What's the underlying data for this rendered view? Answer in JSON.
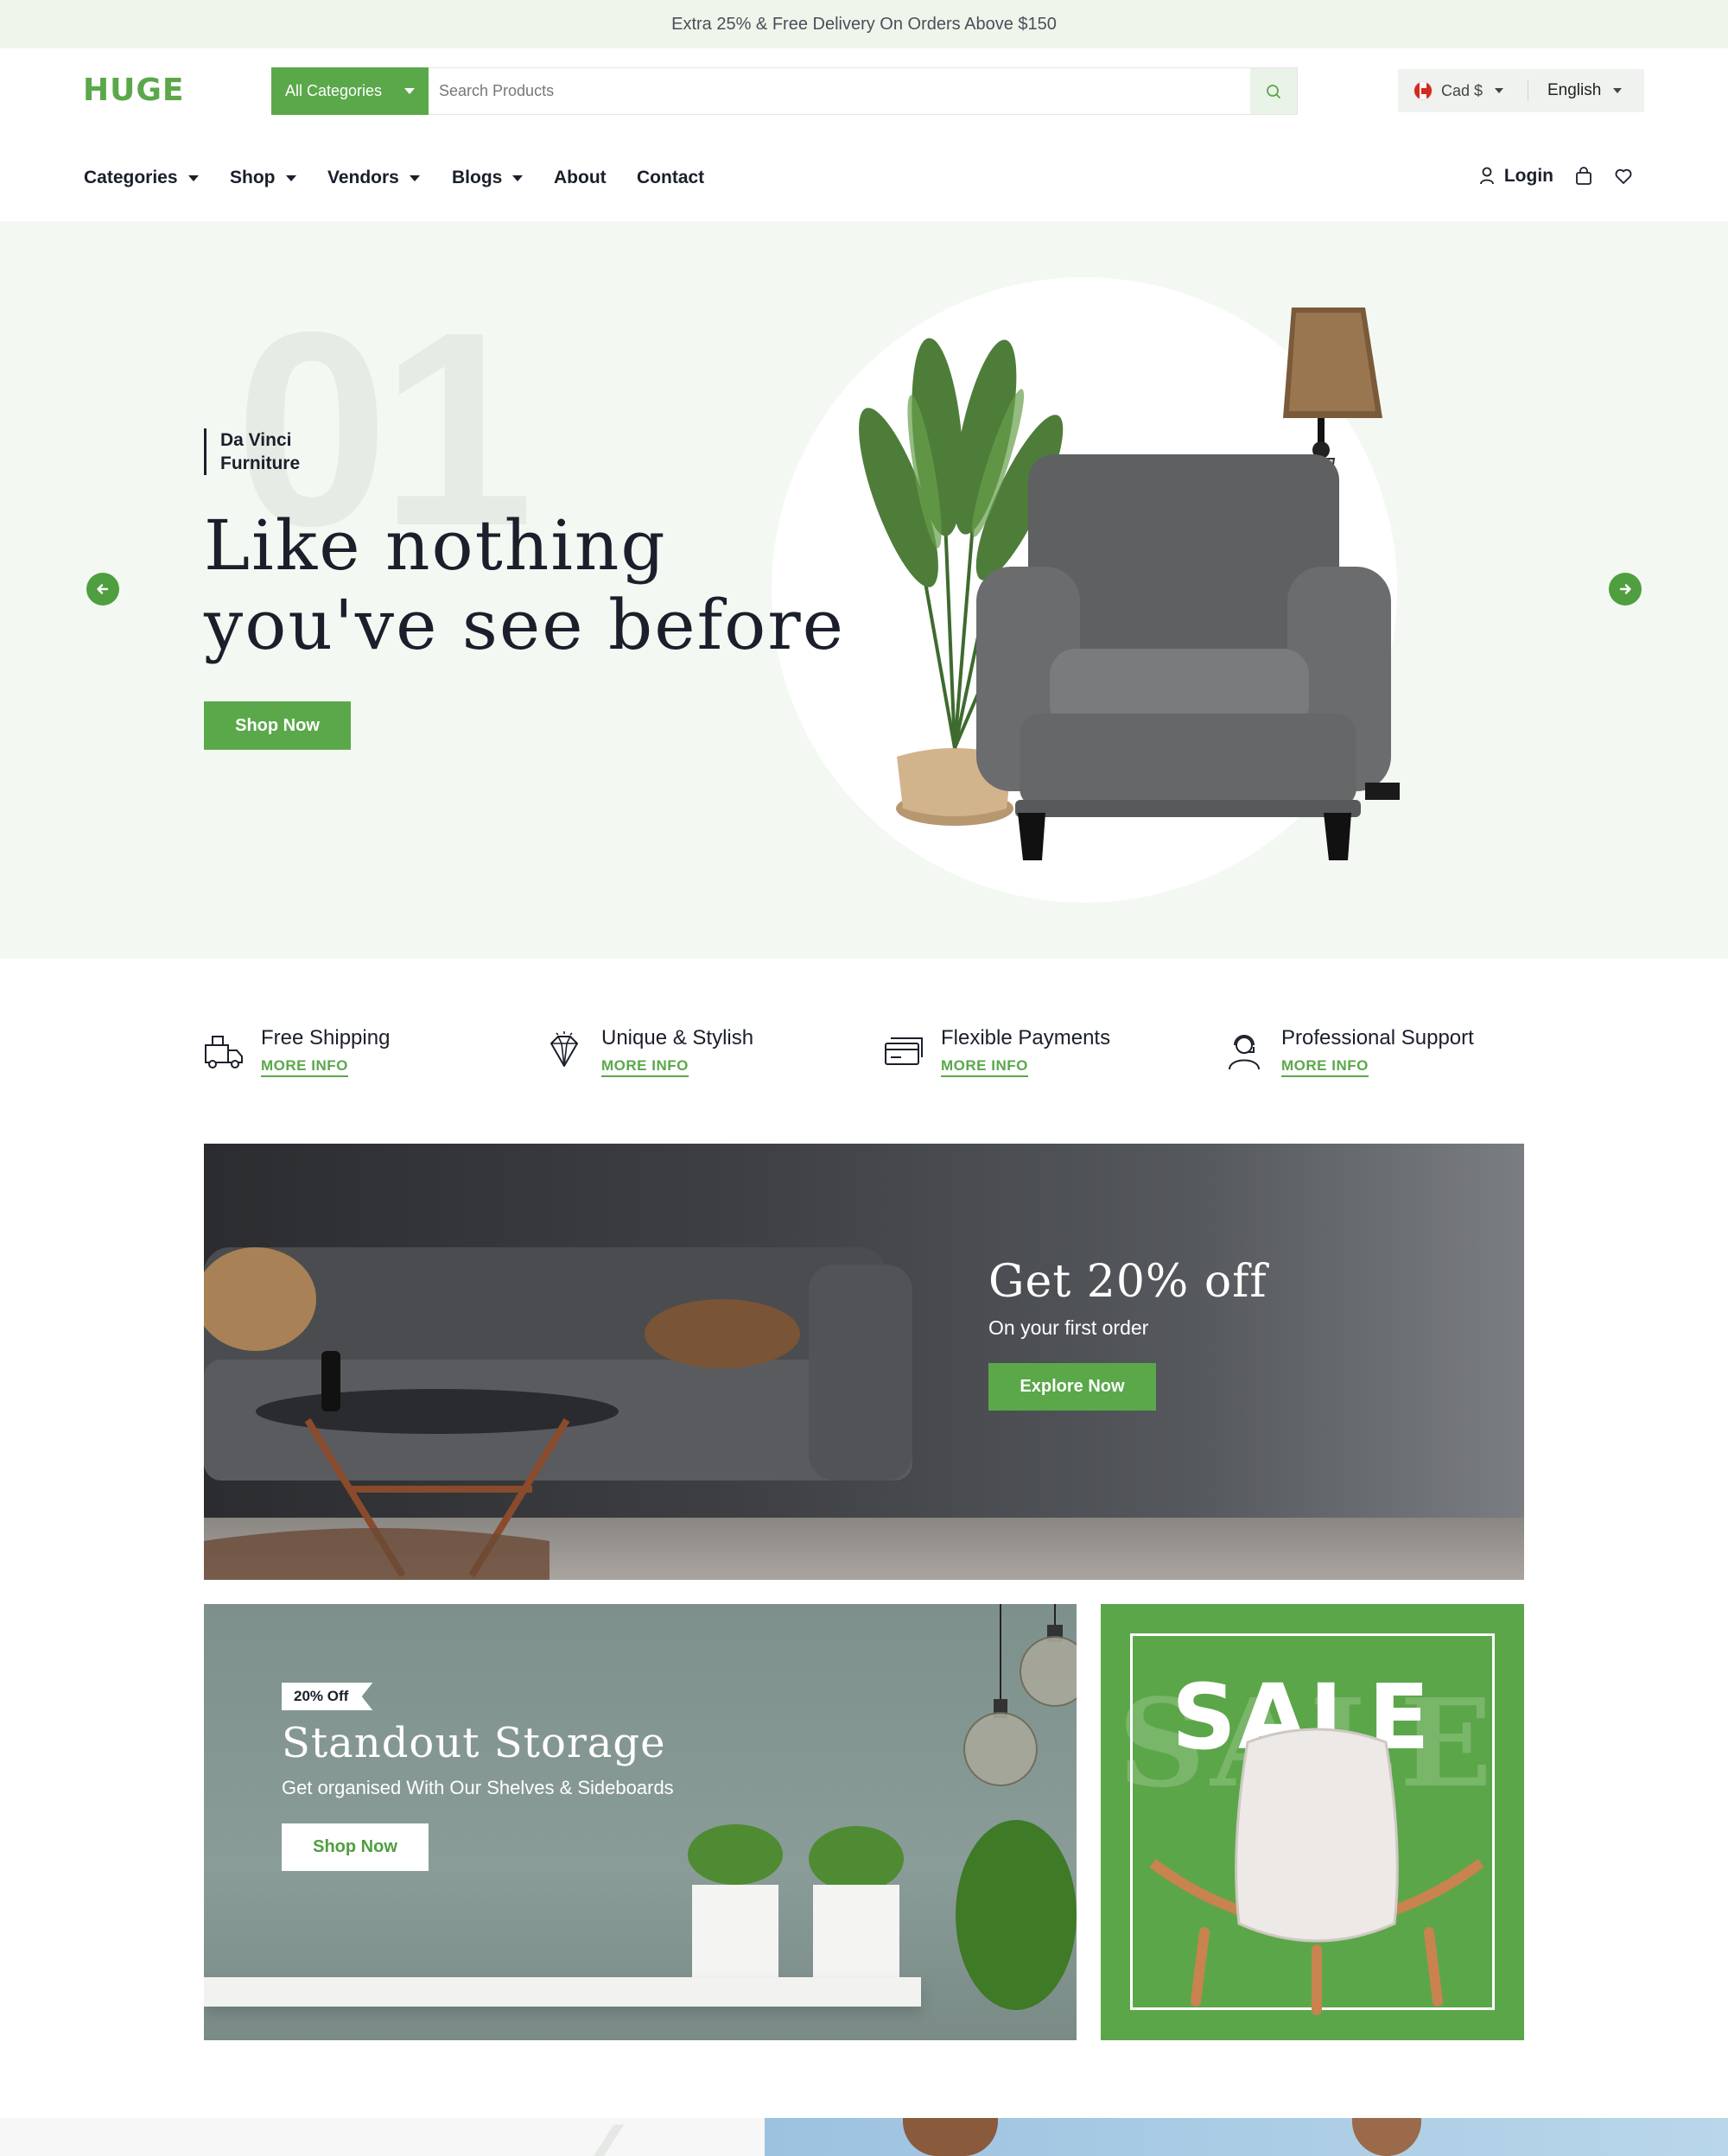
{
  "promo": {
    "text": "Extra 25% & Free Delivery On Orders Above $150"
  },
  "header": {
    "logo": "HUGE",
    "search": {
      "category": "All Categories",
      "placeholder": "Search Products"
    },
    "currency": "Cad $",
    "language": "English"
  },
  "nav": {
    "items": [
      {
        "label": "Categories",
        "has_dropdown": true
      },
      {
        "label": "Shop",
        "has_dropdown": true
      },
      {
        "label": "Vendors",
        "has_dropdown": true
      },
      {
        "label": "Blogs",
        "has_dropdown": true
      },
      {
        "label": "About",
        "has_dropdown": false
      },
      {
        "label": "Contact",
        "has_dropdown": false
      }
    ],
    "login": "Login"
  },
  "hero": {
    "slide_number": "01",
    "brand_line1": "Da Vinci",
    "brand_line2": "Furniture",
    "title_line1": "Like nothing",
    "title_line2": "you've see before",
    "cta": "Shop Now"
  },
  "features": [
    {
      "title": "Free Shipping",
      "link": "MORE INFO",
      "icon": "truck-icon"
    },
    {
      "title": "Unique & Stylish",
      "link": "MORE INFO",
      "icon": "diamond-icon"
    },
    {
      "title": "Flexible Payments",
      "link": "MORE INFO",
      "icon": "card-icon"
    },
    {
      "title": "Professional Support",
      "link": "MORE INFO",
      "icon": "support-agent-icon"
    }
  ],
  "banner_offer": {
    "title": "Get 20% off",
    "subtitle": "On your first order",
    "cta": "Explore Now"
  },
  "banner_storage": {
    "tag": "20% Off",
    "title": "Standout Storage",
    "subtitle": "Get organised With Our Shelves & Sideboards",
    "cta": "Shop Now"
  },
  "banner_sale": {
    "title": "SALE"
  },
  "colors": {
    "accent": "#5aa84a",
    "promo_bg": "#eef6ec",
    "hero_bg": "#f3f9f2",
    "text": "#1a1f2b"
  }
}
